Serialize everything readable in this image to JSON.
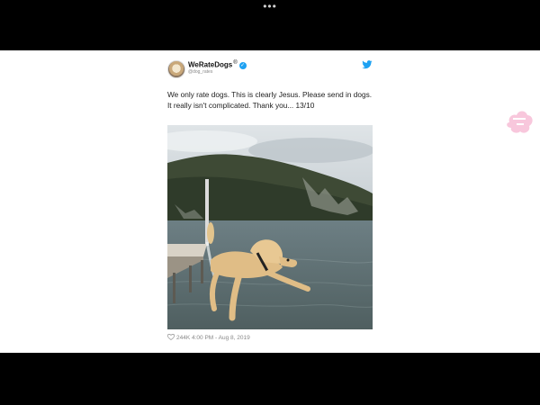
{
  "viewer": {
    "more_glyph": "•••"
  },
  "tweet": {
    "author_name": "WeRateDogs",
    "author_suffix": "®",
    "handle": "@dog_rates",
    "text": "We only rate dogs. This is clearly Jesus. Please send in dogs. It really isn't complicated. Thank you... 13/10",
    "likes": "244K",
    "time": "4:00 PM",
    "separator": "-",
    "date": "Aug 8, 2019",
    "icons": [
      "verified-icon",
      "twitter-bird-icon",
      "heart-icon"
    ]
  },
  "media": {
    "description_icon": "dog-jumping-photo"
  },
  "colors": {
    "twitter_blue": "#1da1f2",
    "background": "#000000",
    "card": "#ffffff"
  }
}
